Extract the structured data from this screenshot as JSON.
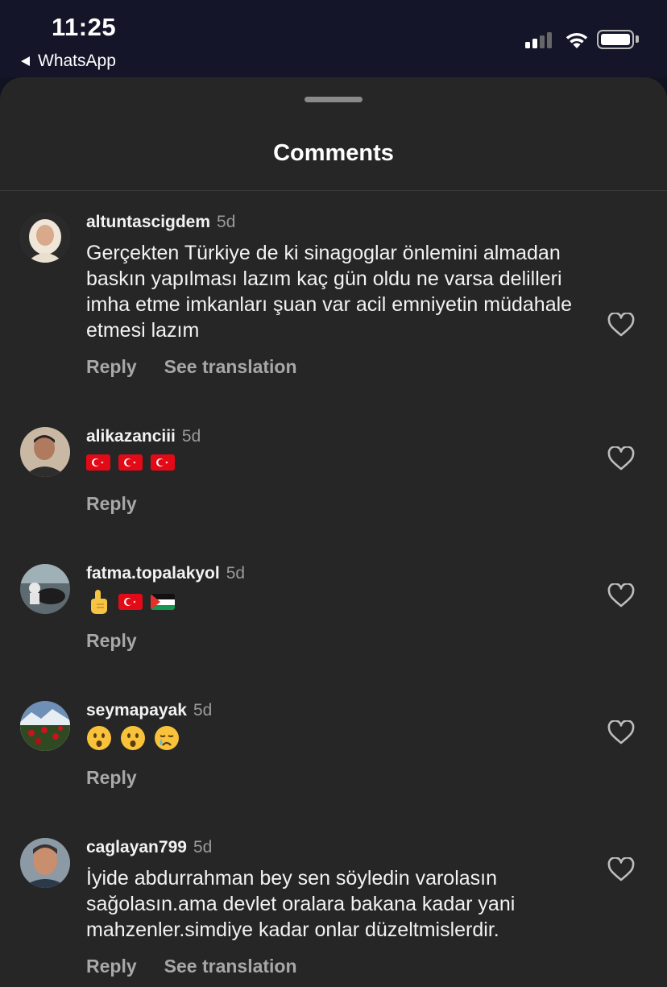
{
  "status_bar": {
    "time": "11:25",
    "back_app": "WhatsApp",
    "icons": [
      "cellular-signal-icon",
      "wifi-icon",
      "battery-icon"
    ]
  },
  "sheet": {
    "title": "Comments"
  },
  "comments": [
    {
      "username": "altuntascigdem",
      "age": "5d",
      "text": "Gerçekten Türkiye de ki sinagoglar önlemini almadan baskın yapılması lazım kaç gün oldu ne varsa delilleri imha etme imkanları şuan var acil emniyetin müdahale etmesi lazım",
      "reply": "Reply",
      "translation": "See translation"
    },
    {
      "username": "alikazanciii",
      "age": "5d",
      "emojis": [
        "turkey-flag",
        "turkey-flag",
        "turkey-flag"
      ],
      "reply": "Reply"
    },
    {
      "username": "fatma.topalakyol",
      "age": "5d",
      "emojis": [
        "index-pointing-up",
        "turkey-flag",
        "palestine-flag"
      ],
      "reply": "Reply"
    },
    {
      "username": "seymapayak",
      "age": "5d",
      "emojis": [
        "hushed-face",
        "hushed-face",
        "crying-face"
      ],
      "reply": "Reply"
    },
    {
      "username": "caglayan799",
      "age": "5d",
      "text": "İyide abdurrahman bey sen söyledin varolasın sağolasın.ama devlet oralara bakana kadar yani mahzenler.simdiye kadar onlar düzeltmislerdir.",
      "reply": "Reply",
      "translation": "See translation"
    }
  ],
  "colors": {
    "background": "#121320",
    "sheet": "#262626",
    "muted_text": "#a8a8a8",
    "turkey_red": "#e30a17"
  }
}
